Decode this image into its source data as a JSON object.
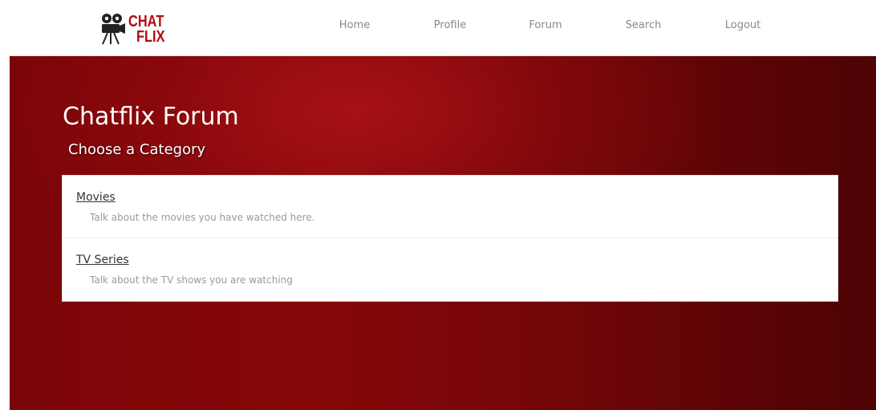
{
  "brand": {
    "logo_line1": "CHAT",
    "logo_line2": "FLIX",
    "logo_icon": "film-projector-icon",
    "accent_color": "#b00b12"
  },
  "nav": {
    "items": [
      {
        "label": "Home"
      },
      {
        "label": "Profile"
      },
      {
        "label": "Forum"
      },
      {
        "label": "Search"
      },
      {
        "label": "Logout"
      }
    ]
  },
  "hero": {
    "title": "Chatflix Forum",
    "subtitle": "Choose a Category",
    "background_color": "#7b0508"
  },
  "categories": [
    {
      "name": "Movies",
      "description": "Talk about the movies you have watched here."
    },
    {
      "name": "TV Series",
      "description": "Talk about the TV shows you are watching"
    }
  ]
}
